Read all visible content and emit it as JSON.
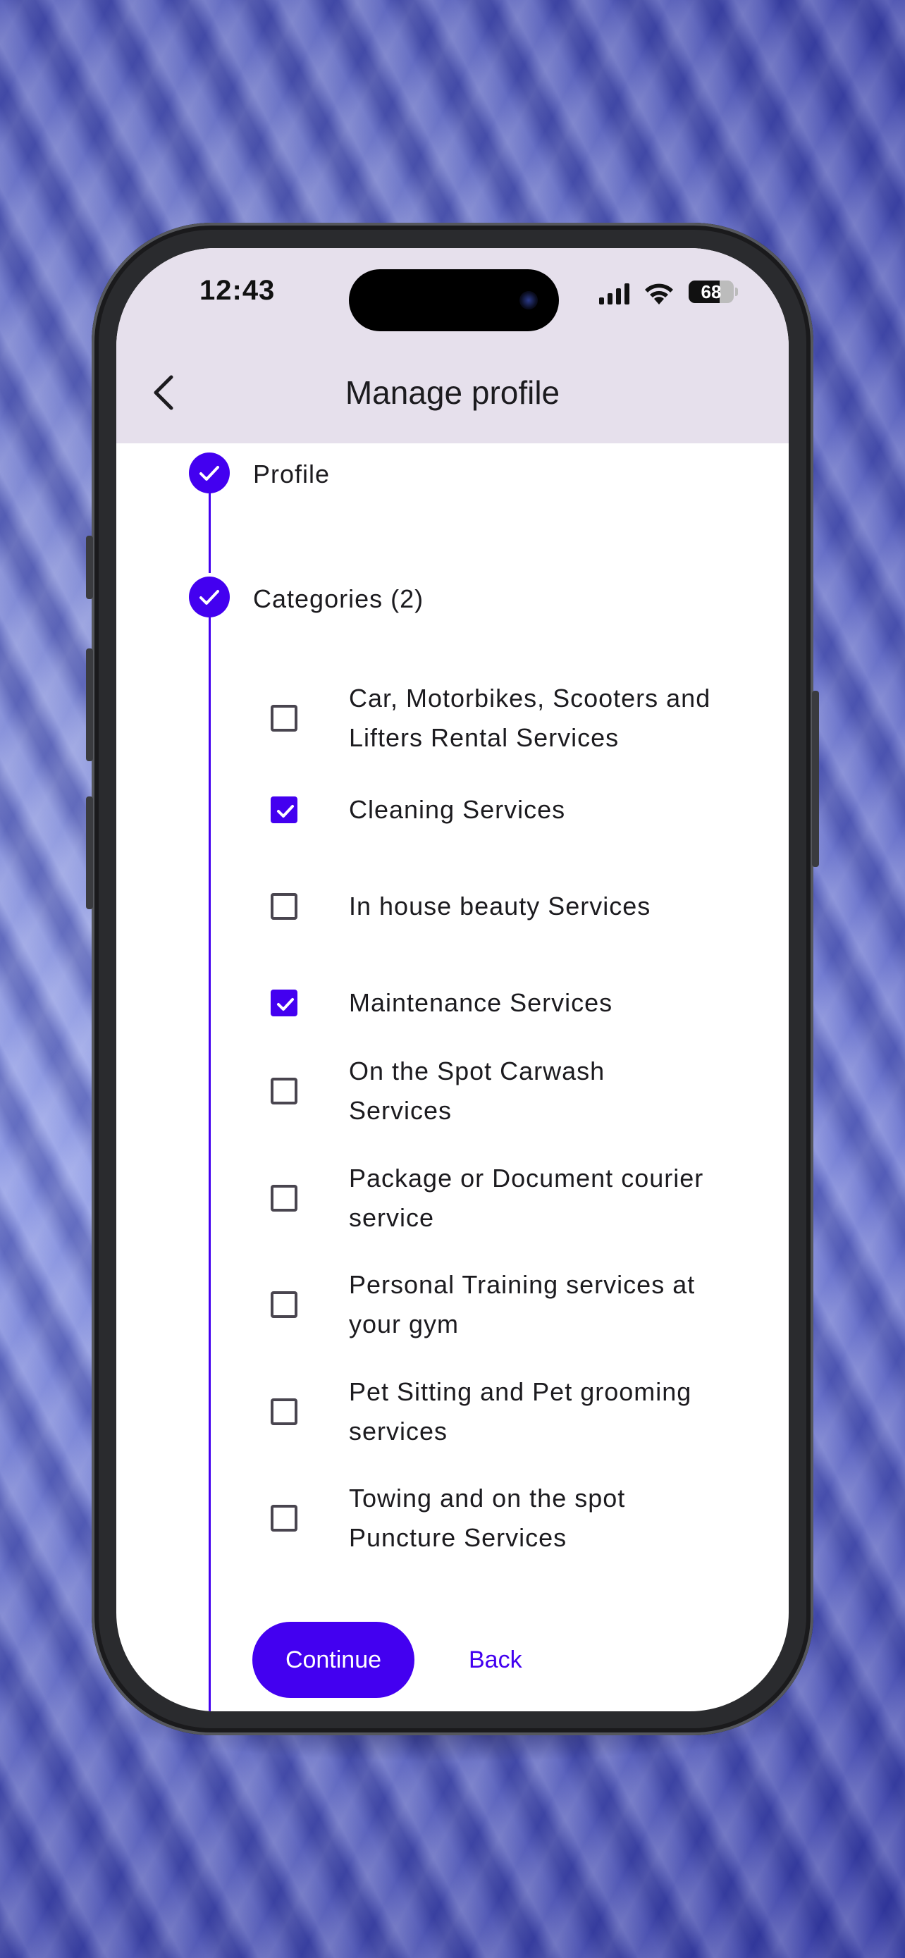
{
  "status_bar": {
    "time": "12:43",
    "battery": "68",
    "battery_level": 0.68
  },
  "header": {
    "title": "Manage profile"
  },
  "stepper": {
    "steps": [
      {
        "label": "Profile",
        "completed": true
      },
      {
        "label": "Categories (2)",
        "completed": true
      }
    ]
  },
  "categories": [
    {
      "label": "Car, Motorbikes, Scooters and Lifters Rental Services",
      "checked": false
    },
    {
      "label": "Cleaning Services",
      "checked": true
    },
    {
      "label": "In house beauty Services",
      "checked": false
    },
    {
      "label": "Maintenance Services",
      "checked": true
    },
    {
      "label": "On the Spot Carwash Services",
      "checked": false
    },
    {
      "label": "Package or Document courier service",
      "checked": false
    },
    {
      "label": "Personal Training services at your gym",
      "checked": false
    },
    {
      "label": "Pet Sitting and Pet grooming services",
      "checked": false
    },
    {
      "label": "Towing and on the spot Puncture Services",
      "checked": false
    }
  ],
  "actions": {
    "continue_label": "Continue",
    "back_label": "Back"
  },
  "colors": {
    "accent": "#4300f0",
    "header_bg": "#e6e0ec"
  }
}
